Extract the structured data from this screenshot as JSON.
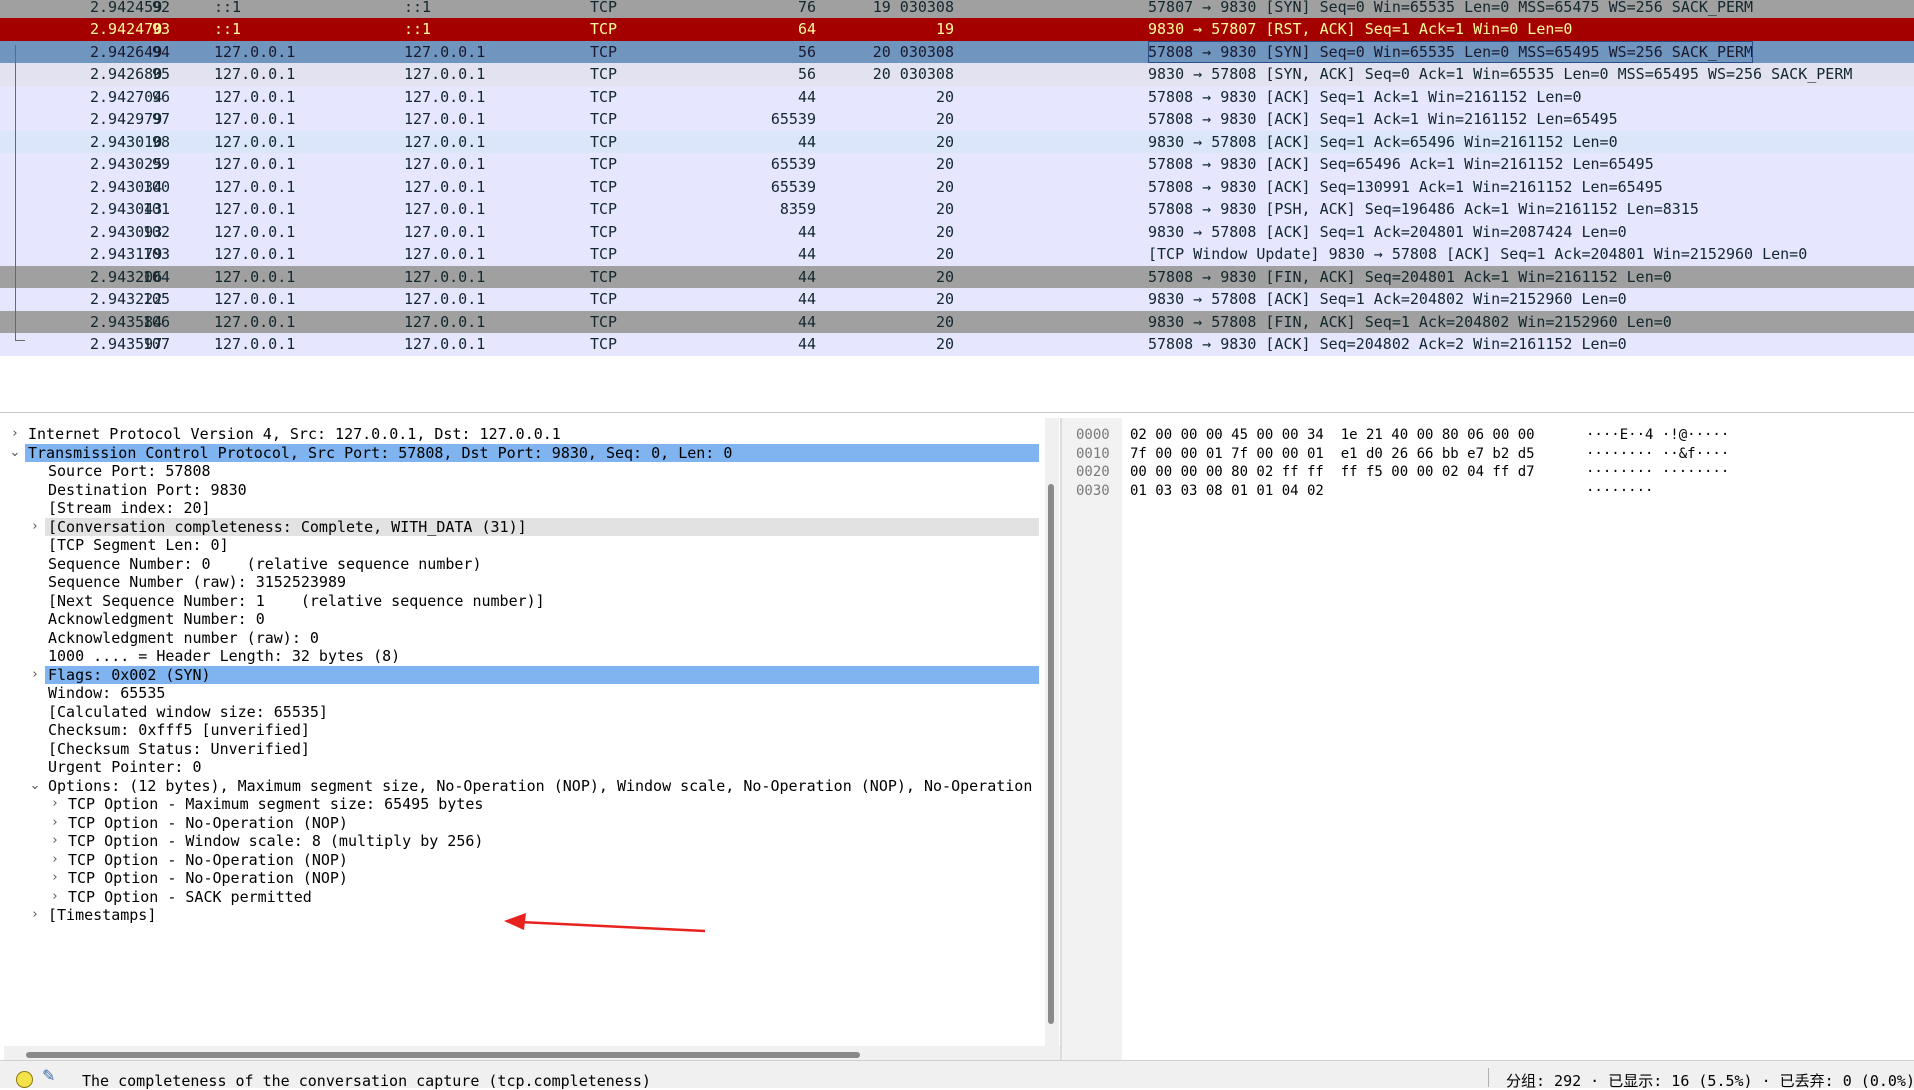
{
  "packets": [
    {
      "no": "92",
      "time": "2.942459",
      "src": "::1",
      "dst": "::1",
      "protocol": "TCP",
      "length": "76",
      "header": "19 030308",
      "info": "57807 → 9830 [SYN] Seq=0 Win=65535 Len=0 MSS=65475 WS=256 SACK_PERM",
      "color": "gray"
    },
    {
      "no": "93",
      "time": "2.942470",
      "src": "::1",
      "dst": "::1",
      "protocol": "TCP",
      "length": "64",
      "header": "19",
      "info": "9830 → 57807 [RST, ACK] Seq=1 Ack=1 Win=0 Len=0",
      "color": "red"
    },
    {
      "no": "94",
      "time": "2.942649",
      "src": "127.0.0.1",
      "dst": "127.0.0.1",
      "protocol": "TCP",
      "length": "56",
      "header": "20 030308",
      "info": "57808 → 9830 [SYN] Seq=0 Win=65535 Len=0 MSS=65495 WS=256 SACK_PERM",
      "color": "selected"
    },
    {
      "no": "95",
      "time": "2.942680",
      "src": "127.0.0.1",
      "dst": "127.0.0.1",
      "protocol": "TCP",
      "length": "56",
      "header": "20 030308",
      "info": "9830 → 57808 [SYN, ACK] Seq=0 Ack=1 Win=65535 Len=0 MSS=65495 WS=256 SACK_PERM",
      "color": "light"
    },
    {
      "no": "96",
      "time": "2.942704",
      "src": "127.0.0.1",
      "dst": "127.0.0.1",
      "protocol": "TCP",
      "length": "44",
      "header": "20",
      "info": "57808 → 9830 [ACK] Seq=1 Ack=1 Win=2161152 Len=0",
      "color": "normal"
    },
    {
      "no": "97",
      "time": "2.942979",
      "src": "127.0.0.1",
      "dst": "127.0.0.1",
      "protocol": "TCP",
      "length": "65539",
      "header": "20",
      "info": "57808 → 9830 [ACK] Seq=1 Ack=1 Win=2161152 Len=65495",
      "color": "normal"
    },
    {
      "no": "98",
      "time": "2.943010",
      "src": "127.0.0.1",
      "dst": "127.0.0.1",
      "protocol": "TCP",
      "length": "44",
      "header": "20",
      "info": "9830 → 57808 [ACK] Seq=1 Ack=65496 Win=2161152 Len=0",
      "color": "blue"
    },
    {
      "no": "99",
      "time": "2.943025",
      "src": "127.0.0.1",
      "dst": "127.0.0.1",
      "protocol": "TCP",
      "length": "65539",
      "header": "20",
      "info": "57808 → 9830 [ACK] Seq=65496 Ack=1 Win=2161152 Len=65495",
      "color": "normal"
    },
    {
      "no": "100",
      "time": "2.943034",
      "src": "127.0.0.1",
      "dst": "127.0.0.1",
      "protocol": "TCP",
      "length": "65539",
      "header": "20",
      "info": "57808 → 9830 [ACK] Seq=130991 Ack=1 Win=2161152 Len=65495",
      "color": "normal"
    },
    {
      "no": "101",
      "time": "2.943043",
      "src": "127.0.0.1",
      "dst": "127.0.0.1",
      "protocol": "TCP",
      "length": "8359",
      "header": "20",
      "info": "57808 → 9830 [PSH, ACK] Seq=196486 Ack=1 Win=2161152 Len=8315",
      "color": "normal"
    },
    {
      "no": "102",
      "time": "2.943093",
      "src": "127.0.0.1",
      "dst": "127.0.0.1",
      "protocol": "TCP",
      "length": "44",
      "header": "20",
      "info": "9830 → 57808 [ACK] Seq=1 Ack=204801 Win=2087424 Len=0",
      "color": "normal"
    },
    {
      "no": "103",
      "time": "2.943179",
      "src": "127.0.0.1",
      "dst": "127.0.0.1",
      "protocol": "TCP",
      "length": "44",
      "header": "20",
      "info": "[TCP Window Update] 9830 → 57808 [ACK] Seq=1 Ack=204801 Win=2152960 Len=0",
      "color": "normal"
    },
    {
      "no": "104",
      "time": "2.943206",
      "src": "127.0.0.1",
      "dst": "127.0.0.1",
      "protocol": "TCP",
      "length": "44",
      "header": "20",
      "info": "57808 → 9830 [FIN, ACK] Seq=204801 Ack=1 Win=2161152 Len=0",
      "color": "gray"
    },
    {
      "no": "105",
      "time": "2.943222",
      "src": "127.0.0.1",
      "dst": "127.0.0.1",
      "protocol": "TCP",
      "length": "44",
      "header": "20",
      "info": "9830 → 57808 [ACK] Seq=1 Ack=204802 Win=2152960 Len=0",
      "color": "normal"
    },
    {
      "no": "106",
      "time": "2.943584",
      "src": "127.0.0.1",
      "dst": "127.0.0.1",
      "protocol": "TCP",
      "length": "44",
      "header": "20",
      "info": "9830 → 57808 [FIN, ACK] Seq=1 Ack=204802 Win=2152960 Len=0",
      "color": "gray"
    },
    {
      "no": "107",
      "time": "2.943597",
      "src": "127.0.0.1",
      "dst": "127.0.0.1",
      "protocol": "TCP",
      "length": "44",
      "header": "20",
      "info": "57808 → 9830 [ACK] Seq=204802 Ack=2 Win=2161152 Len=0",
      "color": "normal"
    }
  ],
  "details": [
    {
      "text": "Internet Protocol Version 4, Src: 127.0.0.1, Dst: 127.0.0.1",
      "indent": 0,
      "expander": "collapsed",
      "highlight": "none"
    },
    {
      "text": "Transmission Control Protocol, Src Port: 57808, Dst Port: 9830, Seq: 0, Len: 0",
      "indent": 0,
      "expander": "expanded",
      "highlight": "blue"
    },
    {
      "text": "Source Port: 57808",
      "indent": 1,
      "expander": "none",
      "highlight": "none"
    },
    {
      "text": "Destination Port: 9830",
      "indent": 1,
      "expander": "none",
      "highlight": "none"
    },
    {
      "text": "[Stream index: 20]",
      "indent": 1,
      "expander": "none",
      "highlight": "none"
    },
    {
      "text": "[Conversation completeness: Complete, WITH_DATA (31)]",
      "indent": 1,
      "expander": "collapsed",
      "highlight": "gray"
    },
    {
      "text": "[TCP Segment Len: 0]",
      "indent": 1,
      "expander": "none",
      "highlight": "none"
    },
    {
      "text": "Sequence Number: 0    (relative sequence number)",
      "indent": 1,
      "expander": "none",
      "highlight": "none"
    },
    {
      "text": "Sequence Number (raw): 3152523989",
      "indent": 1,
      "expander": "none",
      "highlight": "none"
    },
    {
      "text": "[Next Sequence Number: 1    (relative sequence number)]",
      "indent": 1,
      "expander": "none",
      "highlight": "none"
    },
    {
      "text": "Acknowledgment Number: 0",
      "indent": 1,
      "expander": "none",
      "highlight": "none"
    },
    {
      "text": "Acknowledgment number (raw): 0",
      "indent": 1,
      "expander": "none",
      "highlight": "none"
    },
    {
      "text": "1000 .... = Header Length: 32 bytes (8)",
      "indent": 1,
      "expander": "none",
      "highlight": "none"
    },
    {
      "text": "Flags: 0x002 (SYN)",
      "indent": 1,
      "expander": "collapsed",
      "highlight": "blue"
    },
    {
      "text": "Window: 65535",
      "indent": 1,
      "expander": "none",
      "highlight": "none"
    },
    {
      "text": "[Calculated window size: 65535]",
      "indent": 1,
      "expander": "none",
      "highlight": "none"
    },
    {
      "text": "Checksum: 0xfff5 [unverified]",
      "indent": 1,
      "expander": "none",
      "highlight": "none"
    },
    {
      "text": "[Checksum Status: Unverified]",
      "indent": 1,
      "expander": "none",
      "highlight": "none"
    },
    {
      "text": "Urgent Pointer: 0",
      "indent": 1,
      "expander": "none",
      "highlight": "none"
    },
    {
      "text": "Options: (12 bytes), Maximum segment size, No-Operation (NOP), Window scale, No-Operation (NOP), No-Operation",
      "indent": 1,
      "expander": "expanded",
      "highlight": "none"
    },
    {
      "text": "TCP Option - Maximum segment size: 65495 bytes",
      "indent": 2,
      "expander": "collapsed",
      "highlight": "none"
    },
    {
      "text": "TCP Option - No-Operation (NOP)",
      "indent": 2,
      "expander": "collapsed",
      "highlight": "none"
    },
    {
      "text": "TCP Option - Window scale: 8 (multiply by 256)",
      "indent": 2,
      "expander": "collapsed",
      "highlight": "none"
    },
    {
      "text": "TCP Option - No-Operation (NOP)",
      "indent": 2,
      "expander": "collapsed",
      "highlight": "none"
    },
    {
      "text": "TCP Option - No-Operation (NOP)",
      "indent": 2,
      "expander": "collapsed",
      "highlight": "none"
    },
    {
      "text": "TCP Option - SACK permitted",
      "indent": 2,
      "expander": "collapsed",
      "highlight": "none"
    },
    {
      "text": "[Timestamps]",
      "indent": 1,
      "expander": "collapsed",
      "highlight": "none"
    }
  ],
  "bytes": [
    {
      "offset": "0000",
      "hex": "02 00 00 00 45 00 00 34  1e 21 40 00 80 06 00 00",
      "ascii": "····E··4 ·!@·····"
    },
    {
      "offset": "0010",
      "hex": "7f 00 00 01 7f 00 00 01  e1 d0 26 66 bb e7 b2 d5",
      "ascii": "········ ··&f····"
    },
    {
      "offset": "0020",
      "hex": "00 00 00 00 80 02 ff ff  ff f5 00 00 02 04 ff d7",
      "ascii": "········ ········"
    },
    {
      "offset": "0030",
      "hex": "01 03 03 08 01 01 04 02",
      "ascii": "········"
    }
  ],
  "status": {
    "text": "The completeness of the conversation capture (tcp.completeness)",
    "stats": "分组: 292 · 已显示: 16 (5.5%) · 已丢弃: 0 (0.0%)"
  },
  "annotation": {
    "type": "red-arrow",
    "target": "TCP Option - Window scale"
  },
  "colors": {
    "row_normal": "#e7e6ff",
    "row_gray": "#a0a0a0",
    "row_red": "#a40000",
    "row_red_text": "#fffc9c",
    "row_selected": "#7096c0",
    "detail_highlight": "#80b4f0",
    "arrow": "#e8231f"
  }
}
